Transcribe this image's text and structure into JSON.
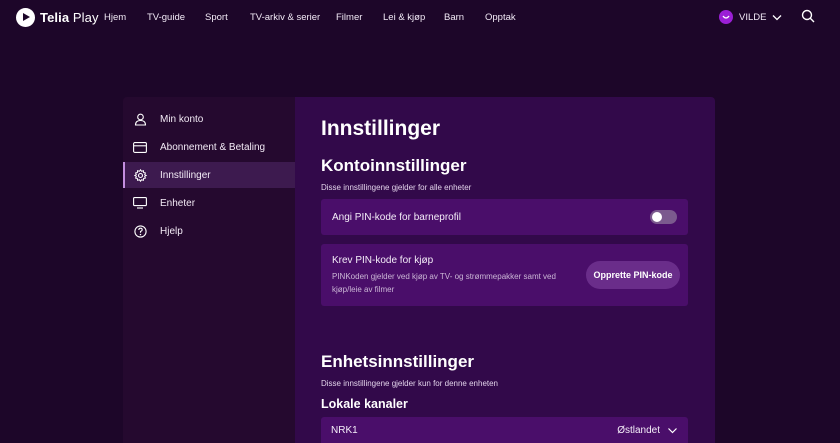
{
  "brand": {
    "name_bold": "Telia",
    "name_light": " Play"
  },
  "nav": [
    {
      "label": "Hjem"
    },
    {
      "label": "TV-guide"
    },
    {
      "label": "Sport"
    },
    {
      "label": "TV-arkiv & serier"
    },
    {
      "label": "Filmer"
    },
    {
      "label": "Lei & kjøp"
    },
    {
      "label": "Barn"
    },
    {
      "label": "Opptak"
    }
  ],
  "user": {
    "name": "VILDE"
  },
  "sidebar": {
    "items": [
      {
        "label": "Min konto",
        "icon": "person-icon"
      },
      {
        "label": "Abonnement & Betaling",
        "icon": "credit-card-icon"
      },
      {
        "label": "Innstillinger",
        "icon": "gear-icon",
        "active": true
      },
      {
        "label": "Enheter",
        "icon": "monitor-icon"
      },
      {
        "label": "Hjelp",
        "icon": "help-icon"
      }
    ]
  },
  "main": {
    "title": "Innstillinger",
    "account": {
      "heading": "Kontoinnstillinger",
      "subtitle": "Disse innstillingene gjelder for alle enheter",
      "pin_child": {
        "label": "Angi PIN-kode for barneprofil",
        "enabled": false
      },
      "pin_purchase": {
        "label": "Krev PIN-kode for kjøp",
        "description": "PINKoden gjelder ved kjøp av TV- og strømmepakker samt ved kjøp/leie av filmer",
        "button": "Opprette PIN-kode"
      }
    },
    "device": {
      "heading": "Enhetsinnstillinger",
      "subtitle": "Disse innstillingene gjelder kun for denne enheten",
      "local_channels": {
        "heading": "Lokale kanaler",
        "channel": "NRK1",
        "region": "Østlandet"
      }
    }
  },
  "colors": {
    "background": "#1d0629",
    "sidebar": "#25092f",
    "panel": "#32094a",
    "card": "#4a0e6a",
    "accent": "#9b1fd6"
  }
}
